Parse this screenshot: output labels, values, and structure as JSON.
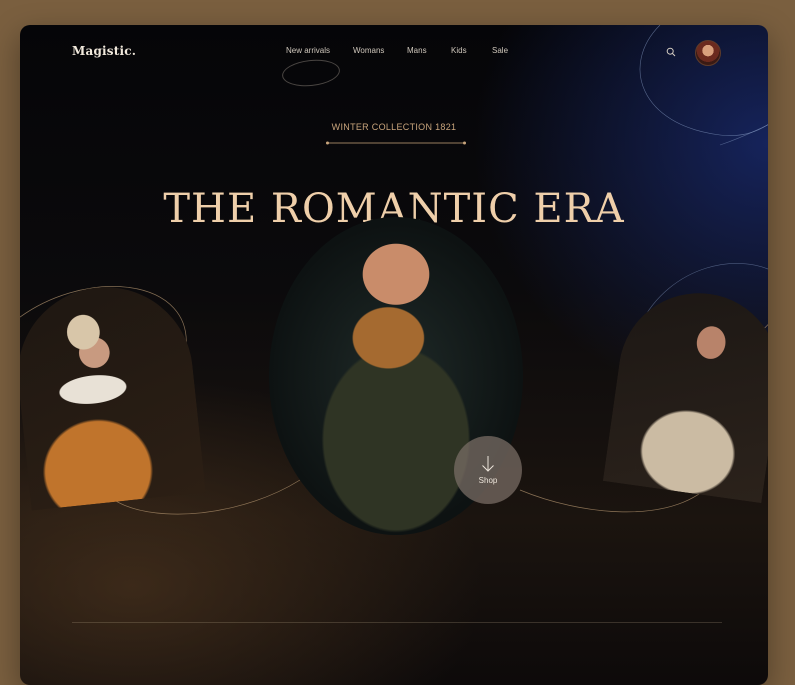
{
  "brand": {
    "logo": "Magistic."
  },
  "nav": {
    "items": [
      {
        "label": "New arrivals",
        "active": true
      },
      {
        "label": "Womans"
      },
      {
        "label": "Mans"
      },
      {
        "label": "Kids"
      },
      {
        "label": "Sale"
      }
    ]
  },
  "header_actions": {
    "search_icon": "search-icon",
    "avatar": "user-avatar"
  },
  "hero": {
    "subtitle": "WINTER COLLECTION 1821",
    "title": "THE ROMANTIC ERA",
    "shop_label": "Shop",
    "shop_icon": "arrow-down-icon"
  },
  "colors": {
    "accent_gold": "#efcfaa",
    "subtitle_gold": "#c9a57d",
    "background_dark": "#0b0a0c",
    "blue_glow": "#182869",
    "outer_bg": "#7a5f3f"
  }
}
